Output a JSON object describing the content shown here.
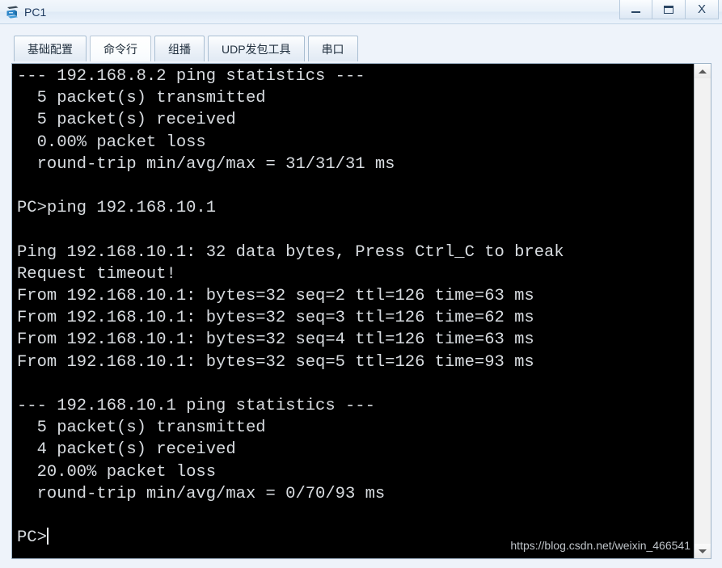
{
  "window": {
    "title": "PC1",
    "icon": "pc-device-icon",
    "buttons": {
      "minimize_label": "_",
      "maximize_label": "□",
      "close_label": "X"
    }
  },
  "tabs": [
    {
      "id": "basic-config",
      "label": "基础配置",
      "active": false
    },
    {
      "id": "command-line",
      "label": "命令行",
      "active": true
    },
    {
      "id": "multicast",
      "label": "组播",
      "active": false
    },
    {
      "id": "udp-tool",
      "label": "UDP发包工具",
      "active": false
    },
    {
      "id": "serial-port",
      "label": "串口",
      "active": false
    }
  ],
  "terminal": {
    "background_color": "#000000",
    "text_color": "#d8dce0",
    "lines": [
      "--- 192.168.8.2 ping statistics ---",
      "  5 packet(s) transmitted",
      "  5 packet(s) received",
      "  0.00% packet loss",
      "  round-trip min/avg/max = 31/31/31 ms",
      "",
      "PC>ping 192.168.10.1",
      "",
      "Ping 192.168.10.1: 32 data bytes, Press Ctrl_C to break",
      "Request timeout!",
      "From 192.168.10.1: bytes=32 seq=2 ttl=126 time=63 ms",
      "From 192.168.10.1: bytes=32 seq=3 ttl=126 time=62 ms",
      "From 192.168.10.1: bytes=32 seq=4 ttl=126 time=63 ms",
      "From 192.168.10.1: bytes=32 seq=5 ttl=126 time=93 ms",
      "",
      "--- 192.168.10.1 ping statistics ---",
      "  5 packet(s) transmitted",
      "  4 packet(s) received",
      "  20.00% packet loss",
      "  round-trip min/avg/max = 0/70/93 ms",
      ""
    ],
    "prompt": "PC>",
    "watermark": "https://blog.csdn.net/weixin_466541"
  },
  "scrollbar": {
    "up_arrow": "scroll-up-arrow",
    "down_arrow": "scroll-down-arrow"
  }
}
